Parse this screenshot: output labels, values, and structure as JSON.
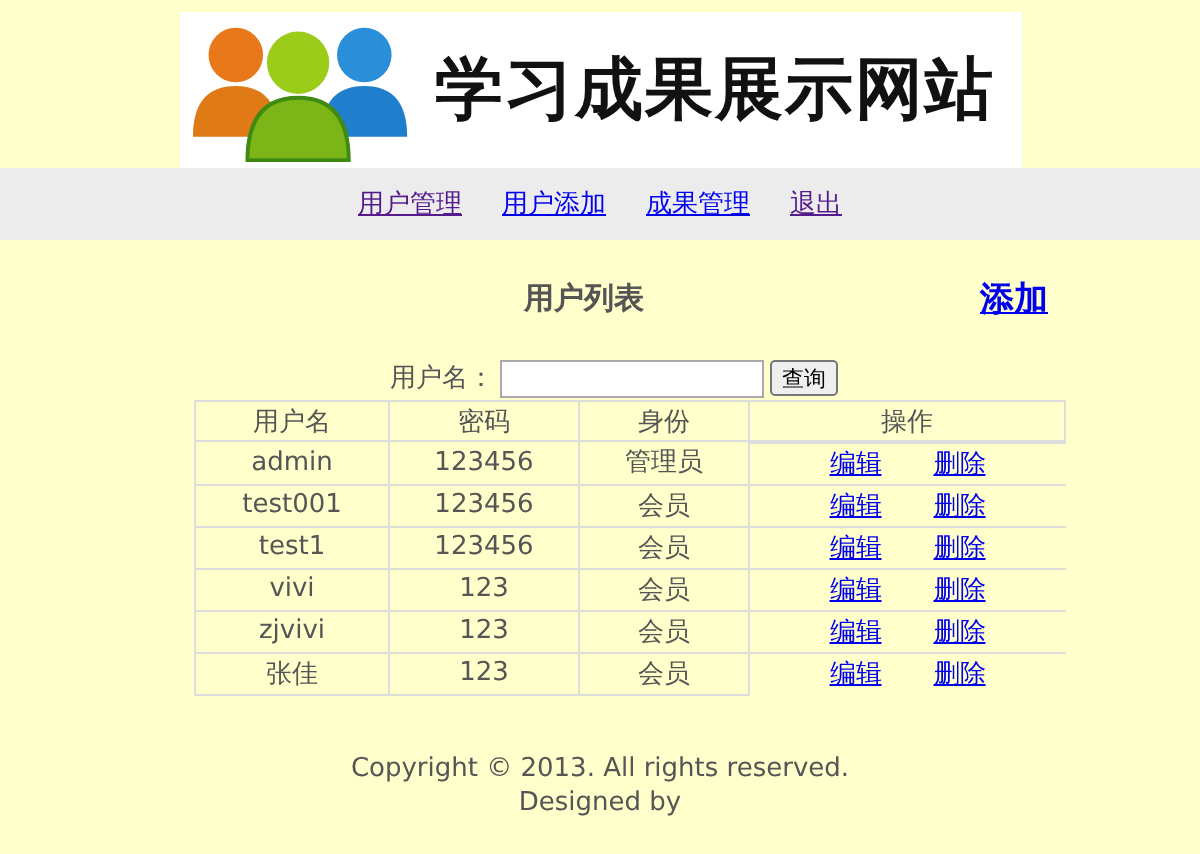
{
  "banner": {
    "title": "学习成果展示网站"
  },
  "nav": [
    {
      "label": "用户管理",
      "visited": true
    },
    {
      "label": "用户添加",
      "visited": false
    },
    {
      "label": "成果管理",
      "visited": false
    },
    {
      "label": "退出",
      "visited": true
    }
  ],
  "heading": "用户列表",
  "add_link": "添加",
  "search": {
    "label": "用户名：",
    "button": "查询"
  },
  "table": {
    "columns": [
      "用户名",
      "密码",
      "身份",
      "操作"
    ],
    "rows": [
      {
        "cells": [
          "admin",
          "123456",
          "管理员"
        ],
        "actions": [
          "编辑",
          "删除"
        ]
      },
      {
        "cells": [
          "test001",
          "123456",
          "会员"
        ],
        "actions": [
          "编辑",
          "删除"
        ]
      },
      {
        "cells": [
          "test1",
          "123456",
          "会员"
        ],
        "actions": [
          "编辑",
          "删除"
        ]
      },
      {
        "cells": [
          "vivi",
          "123",
          "会员"
        ],
        "actions": [
          "编辑",
          "删除"
        ]
      },
      {
        "cells": [
          "zjvivi",
          "123",
          "会员"
        ],
        "actions": [
          "编辑",
          "删除"
        ]
      },
      {
        "cells": [
          "张佳",
          "123",
          "会员"
        ],
        "actions": [
          "编辑",
          "删除"
        ]
      }
    ]
  },
  "footer": [
    "Copyright © 2013. All rights reserved.",
    "Designed by"
  ]
}
